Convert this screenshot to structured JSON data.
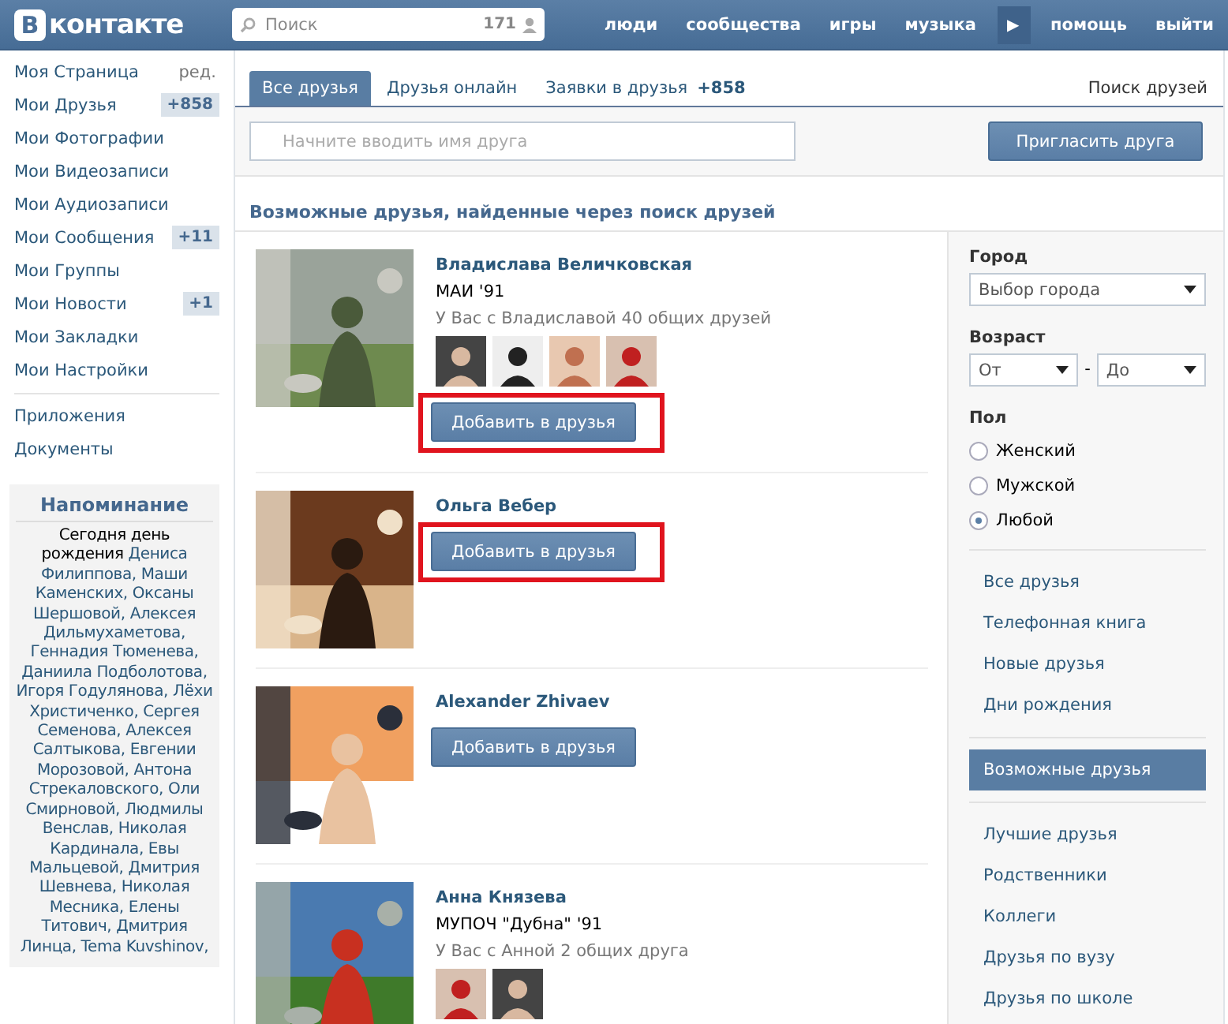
{
  "header": {
    "logo_mark": "В",
    "logo_text": "контакте",
    "search": {
      "placeholder": "Поиск",
      "count": "171"
    },
    "nav": [
      {
        "label": "люди",
        "kind": "link"
      },
      {
        "label": "сообщества",
        "kind": "link"
      },
      {
        "label": "игры",
        "kind": "link"
      },
      {
        "label": "музыка",
        "kind": "link"
      },
      {
        "label": "▶",
        "kind": "play"
      },
      {
        "label": "помощь",
        "kind": "link"
      },
      {
        "label": "выйти",
        "kind": "link"
      }
    ]
  },
  "sidebar": {
    "items": [
      {
        "label": "Моя Страница",
        "extra": "ред.",
        "kind": "edit"
      },
      {
        "label": "Мои Друзья",
        "extra": "+858",
        "kind": "badge"
      },
      {
        "label": "Мои Фотографии",
        "kind": "plain"
      },
      {
        "label": "Мои Видеозаписи",
        "kind": "plain"
      },
      {
        "label": "Мои Аудиозаписи",
        "kind": "plain"
      },
      {
        "label": "Мои Сообщения",
        "extra": "+11",
        "kind": "badge"
      },
      {
        "label": "Мои Группы",
        "kind": "plain"
      },
      {
        "label": "Мои Новости",
        "extra": "+1",
        "kind": "badge"
      },
      {
        "label": "Мои Закладки",
        "kind": "plain"
      },
      {
        "label": "Мои Настройки",
        "kind": "plain"
      }
    ],
    "extra_items": [
      "Приложения",
      "Документы"
    ],
    "reminder": {
      "title": "Напоминание",
      "lead": "Сегодня",
      "event": "день рождения",
      "names": "Дениса Филиппова, Маши Каменских, Оксаны Шершовой, Алексея Дильмухаметова, Геннадия Тюменева, Даниила Подболотова, Игоря Годулянова, Лёхи Христиченко, Сергея Семенова, Алексея Салтыкова, Евгении Морозовой, Антона Стрекаловского, Оли Смирновой, Людмилы Венслав, Николая Кардинала, Евы Мальцевой, Дмитрия Шевнева, Николая Месника, Елены Титович, Дмитрия Линца, Tema Kuvshinov,"
    }
  },
  "tabs": [
    {
      "label": "Все друзья",
      "selected": true
    },
    {
      "label": "Друзья онлайн",
      "selected": false
    },
    {
      "label": "Заявки в друзья",
      "count": "+858",
      "selected": false
    }
  ],
  "tab_link": "Поиск друзей",
  "friend_search": {
    "placeholder": "Начните вводить имя друга"
  },
  "invite_button": "Пригласить друга",
  "section_title": "Возможные друзья, найденные через поиск друзей",
  "suggestions": [
    {
      "name": "Владислава Величковская",
      "school": "МАИ '91",
      "mutual": "У Вас с Владиславой 40 общих друзей",
      "button": "Добавить в друзья",
      "highlighted": true
    },
    {
      "name": "Ольга Вебер",
      "button": "Добавить в друзья",
      "highlighted": true
    },
    {
      "name": "Alexander Zhivaev",
      "button": "Добавить в друзья",
      "highlighted": false
    },
    {
      "name": "Анна Князева",
      "school": "МУПОЧ \"Дубна\" '91",
      "mutual": "У Вас с Анной 2 общих друга"
    }
  ],
  "filters": {
    "city_label": "Город",
    "city_placeholder": "Выбор города",
    "age_label": "Возраст",
    "age_from": "От",
    "age_separator": "-",
    "age_to": "До",
    "sex_label": "Пол",
    "sex_options": [
      {
        "label": "Женский",
        "selected": false
      },
      {
        "label": "Мужской",
        "selected": false
      },
      {
        "label": "Любой",
        "selected": true
      }
    ]
  },
  "menu_groups": [
    [
      {
        "label": "Все друзья",
        "selected": false
      },
      {
        "label": "Телефонная книга",
        "selected": false
      },
      {
        "label": "Новые друзья",
        "selected": false
      },
      {
        "label": "Дни рождения",
        "selected": false
      }
    ],
    [
      {
        "label": "Возможные друзья",
        "selected": true
      }
    ],
    [
      {
        "label": "Лучшие друзья",
        "selected": false
      },
      {
        "label": "Родственники",
        "selected": false
      },
      {
        "label": "Коллеги",
        "selected": false
      },
      {
        "label": "Друзья по вузу",
        "selected": false
      },
      {
        "label": "Друзья по школе",
        "selected": false
      }
    ]
  ]
}
